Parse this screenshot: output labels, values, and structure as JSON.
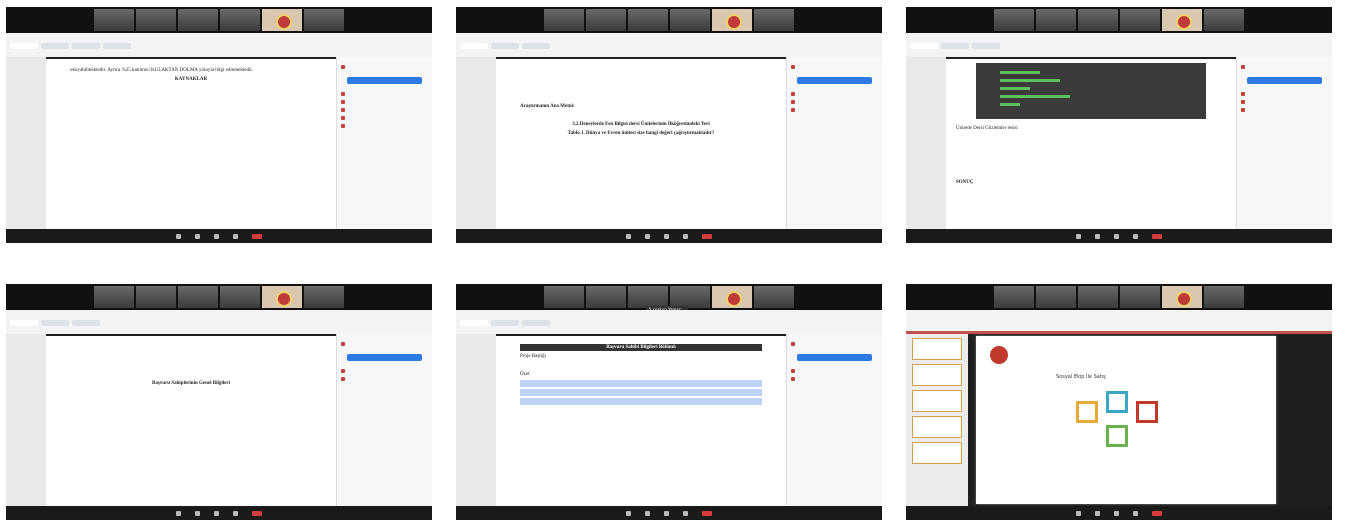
{
  "shots": [
    {
      "kind": "pdf",
      "heading": "KAYNAKLAR",
      "lines": [
        "okuyabilmektedir. Ayrıca %35 katılımcı KULAKTAN DOLMA yoluyla bilgi edinmektedir."
      ]
    },
    {
      "kind": "pdf",
      "heading": "Araştırmanın Ana Metni:",
      "lines": [
        "3.2.Deneylerde Fen Bilgisi dersi Ünitelerinin İlköğretimdeki Yeri",
        "Tablo 1. Dünya ve Evren ünitesi size hangi değeri çağrıştırmaktadır?"
      ]
    },
    {
      "kind": "chart",
      "heading": "SONUÇ",
      "lines": [
        "Ünitede Dersi Gözlemler tesisi"
      ]
    },
    {
      "kind": "pdf",
      "heading": "Başvuru Sahiplerinin Genel Bilgileri",
      "lines": []
    },
    {
      "kind": "form",
      "heading": "Başvuru Sahibi Bilgileri Bölümü",
      "lines": [
        "Proje Başlığı",
        "Özet"
      ],
      "overlay": "5 coşkun Yamaç..."
    },
    {
      "kind": "ppt",
      "heading": "Sosyal Ekip İle Satış",
      "lines": []
    }
  ]
}
